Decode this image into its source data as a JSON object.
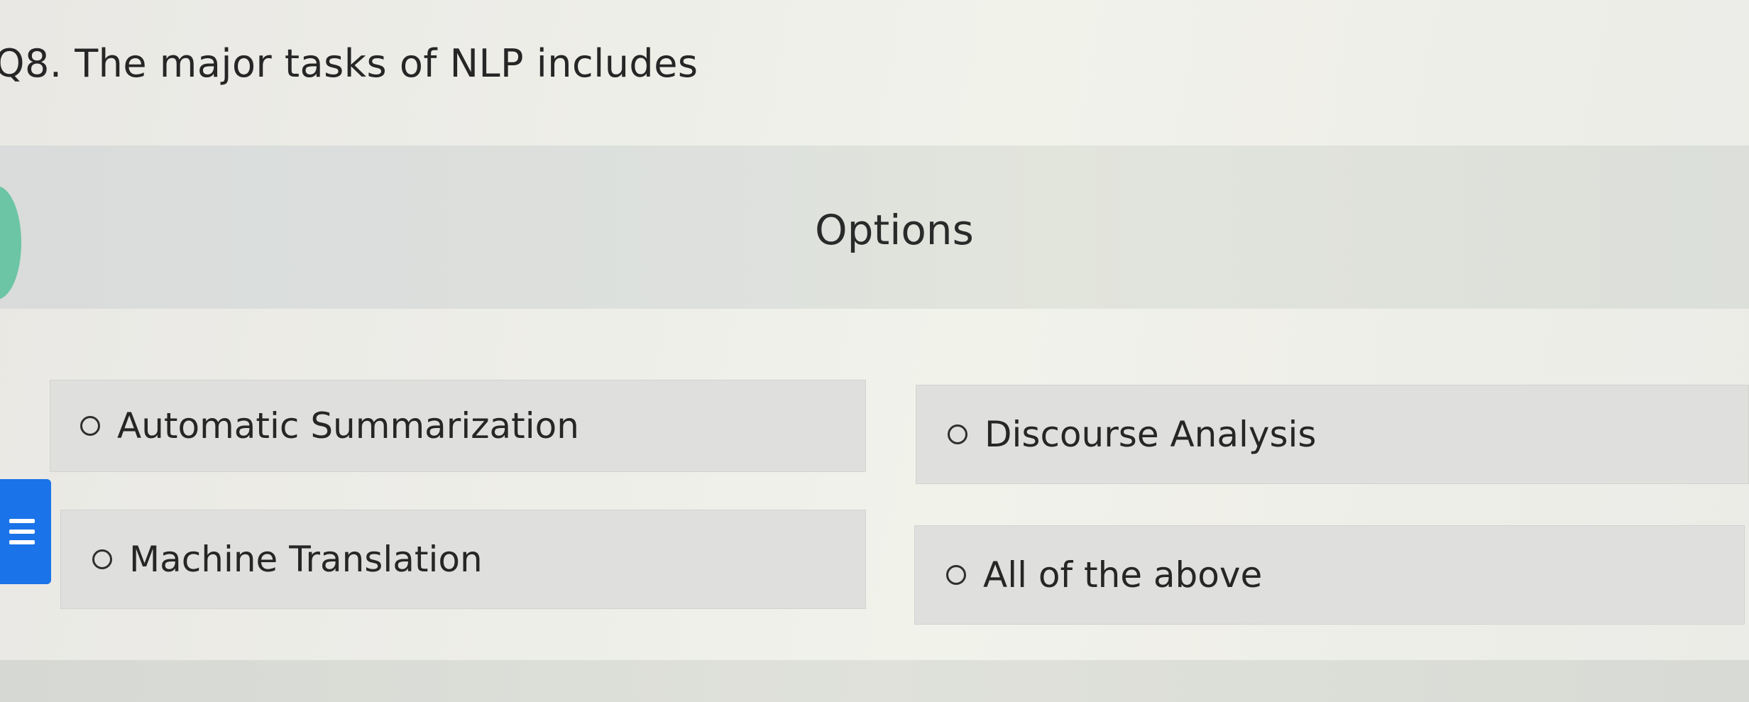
{
  "question": {
    "text": "Q8. The major tasks of NLP includes"
  },
  "options_heading": "Options",
  "options": [
    {
      "label": "Automatic Summarization",
      "selected": false
    },
    {
      "label": "Discourse Analysis",
      "selected": false
    },
    {
      "label": "Machine Translation",
      "selected": false
    },
    {
      "label": "All of the above",
      "selected": false
    }
  ],
  "side_menu": {
    "icon": "menu-icon",
    "color": "#1a73e8"
  }
}
